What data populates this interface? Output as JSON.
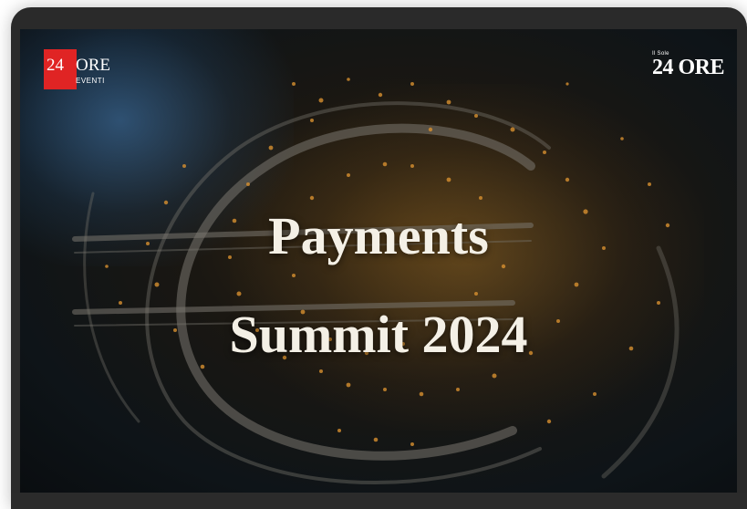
{
  "video": {
    "title_line1": "Payments",
    "title_line2": "Summit 2024"
  },
  "logo_left": {
    "number": "24",
    "word": "ORE",
    "sub": "EVENTI",
    "color": "#e02424"
  },
  "logo_right": {
    "small": "Il Sole",
    "main": "24 ORE"
  },
  "colors": {
    "frame_bg": "#2a2a2a",
    "title_text": "#f4f0e6"
  },
  "icons": {
    "background_art": "euro-symbol-illustration"
  }
}
